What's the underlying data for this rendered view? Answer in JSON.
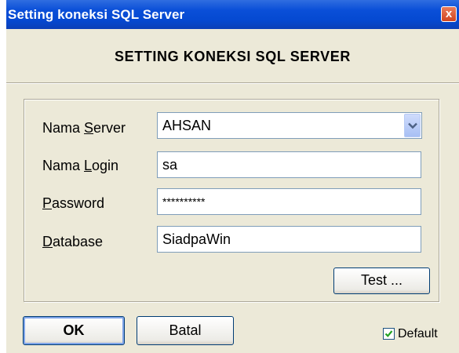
{
  "window": {
    "title": "Setting koneksi SQL Server",
    "close_glyph": "x"
  },
  "heading": "SETTING KONEKSI SQL SERVER",
  "form": {
    "server": {
      "label_pre": "Nama ",
      "label_mnemonic": "S",
      "label_post": "erver",
      "value": "AHSAN"
    },
    "login": {
      "label_pre": "Nama ",
      "label_mnemonic": "L",
      "label_post": "ogin",
      "value": "sa"
    },
    "password": {
      "label_pre": "",
      "label_mnemonic": "P",
      "label_post": "assword",
      "value": "**********"
    },
    "database": {
      "label_pre": "",
      "label_mnemonic": "D",
      "label_post": "atabase",
      "value": "SiadpaWin"
    }
  },
  "buttons": {
    "test": "Test ...",
    "ok": "OK",
    "cancel": "Batal"
  },
  "default_checkbox": {
    "label": "Default",
    "checked": true
  },
  "icons": {
    "close": "close-icon",
    "dropdown": "chevron-down-icon",
    "check": "checkmark-icon"
  },
  "colors": {
    "titlebar": "#0549d1",
    "dialog_bg": "#ece9d8",
    "close": "#d2441f"
  }
}
